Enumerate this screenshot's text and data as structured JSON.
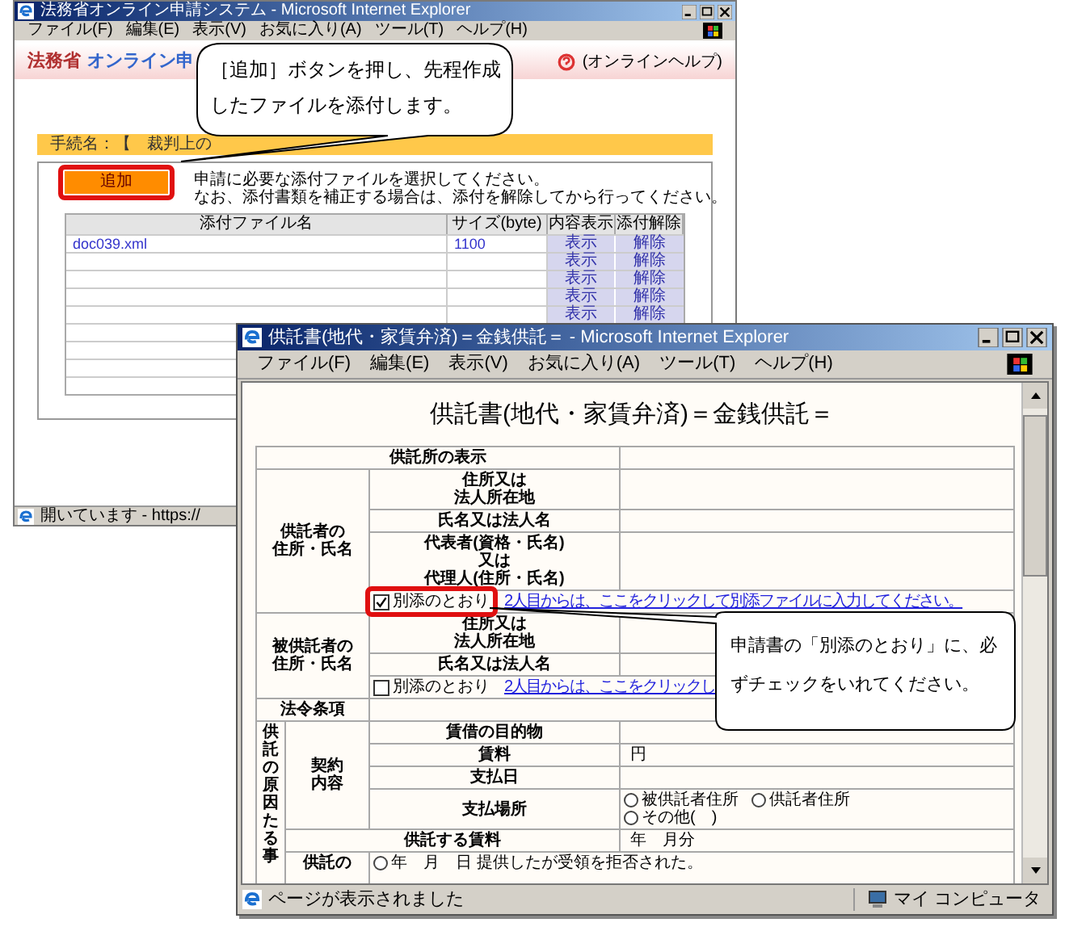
{
  "back_window": {
    "title": "法務省オンライン申請システム - Microsoft Internet Explorer",
    "menu": [
      "ファイル(F)",
      "編集(E)",
      "表示(V)",
      "お気に入り(A)",
      "ツール(T)",
      "ヘルプ(H)"
    ],
    "site_name": "法務省",
    "site_title": "オンライン申",
    "help_link": "(オンラインヘルプ)",
    "procedure_label": "手続名：【　裁判上の",
    "add_button": "追加",
    "instructions": [
      "申請に必要な添付ファイルを選択してください。",
      "なお、添付書類を補正する場合は、添付を解除してから行ってください。"
    ],
    "table": {
      "columns": [
        "添付ファイル名",
        "サイズ(byte)",
        "内容表示",
        "添付解除"
      ],
      "rows": [
        {
          "file": "doc039.xml",
          "size": "1100",
          "view": "表示",
          "detach": "解除"
        },
        {
          "view": "表示",
          "detach": "解除"
        },
        {
          "view": "表示",
          "detach": "解除"
        },
        {
          "view": "表示",
          "detach": "解除"
        },
        {
          "view": "表示",
          "detach": "解除"
        }
      ]
    },
    "status": "開いています - https://"
  },
  "front_window": {
    "title": "供託書(地代・家賃弁済)＝金銭供託＝ - Microsoft Internet Explorer",
    "menu": [
      "ファイル(F)",
      "編集(E)",
      "表示(V)",
      "お気に入り(A)",
      "ツール(T)",
      "ヘルプ(H)"
    ],
    "page_title": "供託書(地代・家賃弁済)＝金銭供託＝",
    "form": {
      "office": {
        "label": "供託所の表示"
      },
      "depositor": {
        "label": [
          "供託者の",
          "住所・氏名"
        ],
        "fields": [
          {
            "label": [
              "住所又は",
              "法人所在地"
            ]
          },
          {
            "label": [
              "氏名又は法人名"
            ]
          },
          {
            "label": [
              "代表者(資格・氏名)",
              "又は",
              "代理人(住所・氏名)"
            ]
          }
        ],
        "attachment": {
          "label": "別添のとおり",
          "checked": true,
          "link": "2人目からは、ここをクリックして別添ファイルに入力してください。"
        }
      },
      "depositee": {
        "label": [
          "被供託者の",
          "住所・氏名"
        ],
        "fields": [
          {
            "label": [
              "住所又は",
              "法人所在地"
            ]
          },
          {
            "label": [
              "氏名又は法人名"
            ]
          }
        ],
        "attachment": {
          "label": "別添のとおり",
          "checked": false,
          "link": "2人目からは、ここをクリックし"
        }
      },
      "law": {
        "label": "法令条項"
      },
      "cause": {
        "label": "供託の原因たる事",
        "contract": {
          "label": "契約内容",
          "rows": [
            {
              "label": "賃借の目的物"
            },
            {
              "label": "賃料",
              "value": "円"
            },
            {
              "label": "支払日"
            },
            {
              "label": "支払場所",
              "options": [
                {
                  "label": "被供託者住所",
                  "selected": false
                },
                {
                  "label": "供託者住所",
                  "selected": false
                },
                {
                  "label": "その他(　)",
                  "selected": false
                }
              ]
            }
          ]
        },
        "rent": {
          "label": "供託する賃料",
          "value": "年　月分"
        },
        "reason": {
          "label": "供託の",
          "options": [
            {
              "label": "年　月　日 提供したが受領を拒否された。",
              "selected": false
            }
          ]
        }
      }
    },
    "status": "ページが表示されました",
    "zone": "マイ コンピュータ"
  },
  "callouts": [
    {
      "text": "［追加］ボタンを押し、先程作成したファイルを添付します。"
    },
    {
      "text": "申請書の「別添のとおり」に、必ずチェックをいれてください。"
    }
  ]
}
